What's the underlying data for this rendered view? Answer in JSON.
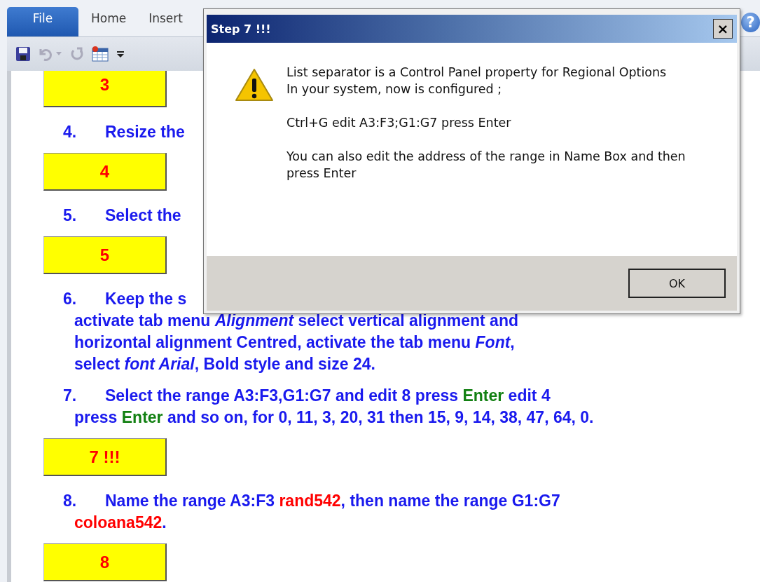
{
  "ribbon": {
    "tabs": [
      {
        "label": "File",
        "selected": true
      },
      {
        "label": "Home",
        "selected": false
      },
      {
        "label": "Insert",
        "selected": false
      }
    ],
    "help": "?"
  },
  "document": {
    "blocks": [
      {
        "kind": "box",
        "text": "3"
      },
      {
        "kind": "step",
        "number": "4.",
        "lines": [
          [
            {
              "text": "Resize the",
              "kind": "plain"
            }
          ]
        ]
      },
      {
        "kind": "box",
        "text": "4"
      },
      {
        "kind": "step",
        "number": "5.",
        "lines": [
          [
            {
              "text": "Select the",
              "kind": "plain"
            }
          ]
        ]
      },
      {
        "kind": "box",
        "text": "5"
      },
      {
        "kind": "step",
        "number": "6.",
        "lines": [
          [
            {
              "text": "Keep the s",
              "kind": "plain"
            }
          ],
          [
            {
              "text": "activate tab menu ",
              "kind": "plain"
            },
            {
              "text": "Alignment",
              "kind": "italic"
            },
            {
              "text": " select vertical alignment and",
              "kind": "plain"
            }
          ],
          [
            {
              "text": "horizontal alignment Centred, activate the tab menu ",
              "kind": "plain"
            },
            {
              "text": "Font",
              "kind": "italic"
            },
            {
              "text": ",",
              "kind": "plain"
            }
          ],
          [
            {
              "text": "select ",
              "kind": "plain"
            },
            {
              "text": "font Arial",
              "kind": "italic"
            },
            {
              "text": ", Bold style and size 24.",
              "kind": "plain"
            }
          ]
        ]
      },
      {
        "kind": "step",
        "number": "7.",
        "lines": [
          [
            {
              "text": "Select the range A3:F3,G1:G7 and edit 8 press ",
              "kind": "plain"
            },
            {
              "text": "Enter",
              "kind": "key"
            },
            {
              "text": " edit 4",
              "kind": "plain"
            }
          ],
          [
            {
              "text": "press ",
              "kind": "plain"
            },
            {
              "text": "Enter",
              "kind": "key"
            },
            {
              "text": " and so on, for 0, 11, 3, 20, 31 then 15, 9, 14, 38, 47, 64, 0.",
              "kind": "plain"
            }
          ]
        ]
      },
      {
        "kind": "box",
        "text": "7 !!!"
      },
      {
        "kind": "step",
        "number": "8.",
        "lines": [
          [
            {
              "text": "Name the range A3:F3 ",
              "kind": "plain"
            },
            {
              "text": "rand542",
              "kind": "name"
            },
            {
              "text": ", then name the range G1:G7",
              "kind": "plain"
            }
          ],
          [
            {
              "text": "coloana542",
              "kind": "name"
            },
            {
              "text": ".",
              "kind": "plain"
            }
          ]
        ]
      },
      {
        "kind": "box",
        "text": "8"
      }
    ]
  },
  "dialog": {
    "title": "Step 7 !!!",
    "close": "×",
    "message": [
      "List separator is a Control Panel property for Regional Options\nIn your system, now is configured ;",
      "Ctrl+G edit A3:F3;G1:G7 press Enter",
      "You can also edit the address of the range in Name Box and then press Enter"
    ],
    "buttons": [
      "OK"
    ]
  }
}
